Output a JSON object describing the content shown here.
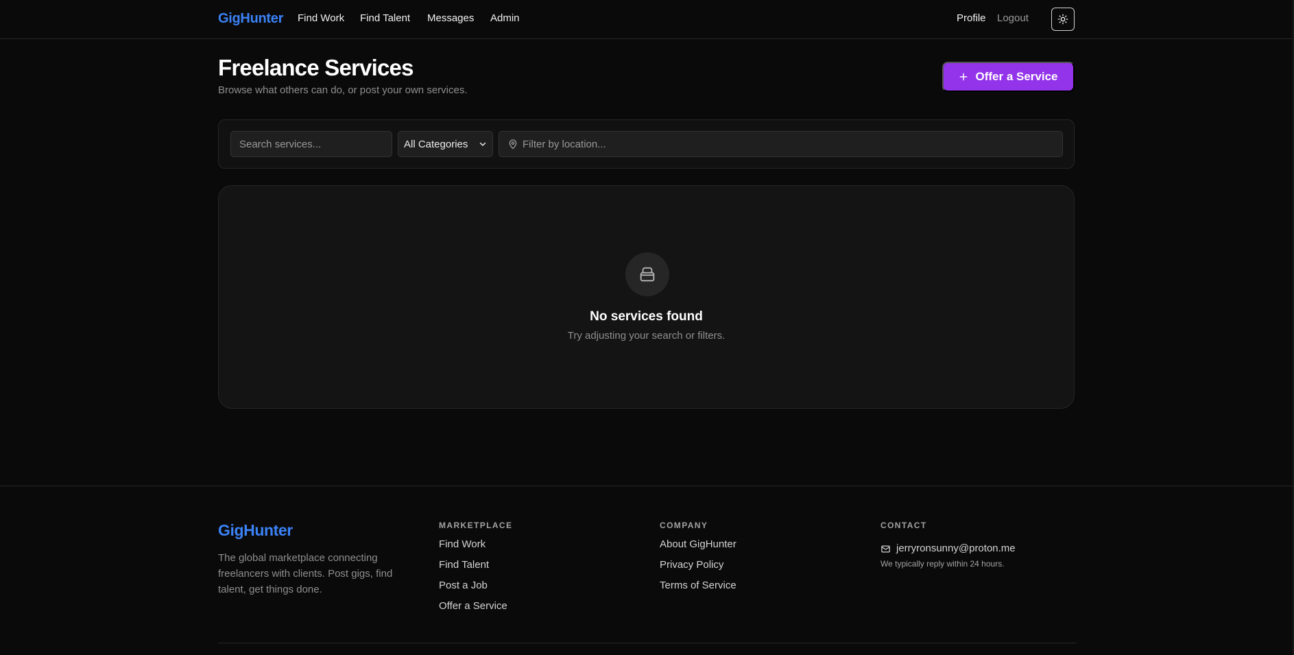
{
  "header": {
    "brand": "GigHunter",
    "nav": [
      "Find Work",
      "Find Talent",
      "Messages",
      "Admin"
    ],
    "profile": "Profile",
    "logout": "Logout",
    "theme_icon": "sun-icon"
  },
  "hero": {
    "title": "Freelance Services",
    "subtitle": "Browse what others can do, or post your own services.",
    "offer_button": "Offer a Service",
    "accent": "#9333ea"
  },
  "filters": {
    "search_placeholder": "Search services...",
    "category_selected": "All Categories",
    "location_placeholder": "Filter by location..."
  },
  "empty_state": {
    "icon": "inbox-icon",
    "title": "No services found",
    "hint": "Try adjusting your search or filters."
  },
  "footer": {
    "brand": "GigHunter",
    "brand_color": "#3b82f6",
    "tagline": "The global marketplace connecting freelancers with clients. Post gigs, find talent, get things done.",
    "marketplace": {
      "heading": "MARKETPLACE",
      "links": [
        "Find Work",
        "Find Talent",
        "Post a Job",
        "Offer a Service"
      ]
    },
    "company": {
      "heading": "COMPANY",
      "links": [
        "About GigHunter",
        "Privacy Policy",
        "Terms of Service"
      ]
    },
    "contact": {
      "heading": "CONTACT",
      "email": "jerryronsunny@proton.me",
      "note": "We typically reply within 24 hours."
    }
  }
}
